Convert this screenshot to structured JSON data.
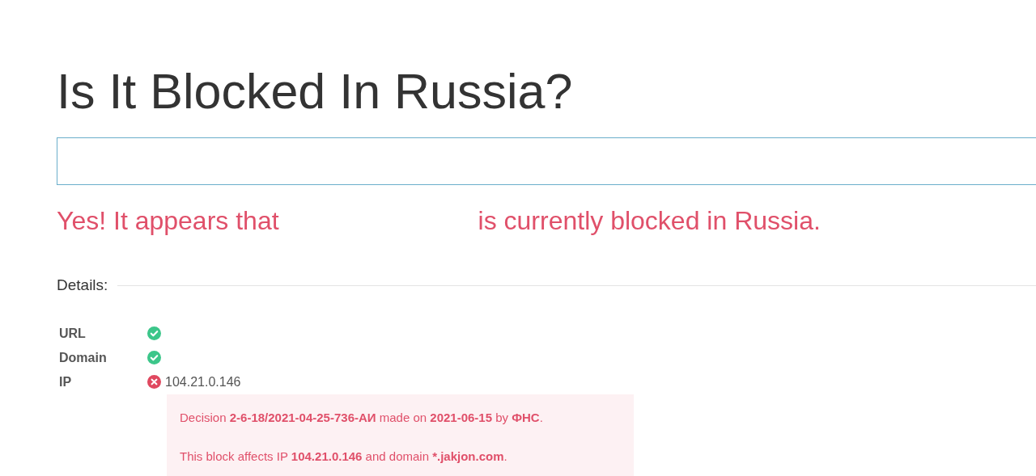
{
  "title": "Is It Blocked In Russia?",
  "result": {
    "lead": "Yes! It appears that",
    "tail": "is currently blocked in Russia."
  },
  "details": {
    "heading": "Details:",
    "rows": [
      {
        "label": "URL",
        "blocked": false
      },
      {
        "label": "Domain",
        "blocked": false
      },
      {
        "label": "IP",
        "blocked": true,
        "value": "104.21.0.146",
        "notes": [
          "Decision **2-6-18/2021-04-25-736-АИ** made on **2021-06-15** by **ФНС**.",
          "This block affects IP **104.21.0.146** and domain ***.jakjon.com**."
        ]
      }
    ]
  }
}
